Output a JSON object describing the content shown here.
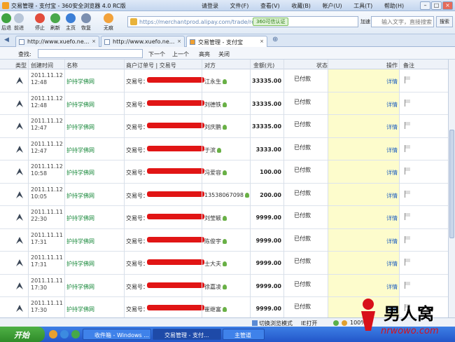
{
  "window": {
    "title": "交易管理 - 支付宝 - 360安全浏览器 4.0 RC版",
    "menus": [
      "请登录",
      "文件(F)",
      "查看(V)",
      "收藏(B)",
      "帐户(U)",
      "工具(T)",
      "帮助(H)"
    ]
  },
  "toolbar": {
    "buttons": [
      "后退",
      "前进",
      "停止",
      "刷新",
      "主页",
      "恢复",
      "无痕"
    ],
    "url": "https://merchantprod.alipay.com/trade/re",
    "cert": "360可信认证",
    "add": "加速",
    "search_placeholder": "输入文字，直接搜索",
    "search_btn": "搜索"
  },
  "tabs": [
    "http://www.xuefo.ne...",
    "http://www.xuefo.ne...",
    "交易管理 - 支付宝"
  ],
  "findbar": {
    "label": "查找:",
    "next": "下一个",
    "prev": "上一个",
    "highlight": "高亮",
    "close": "关闭"
  },
  "table": {
    "headers": [
      "类型",
      "创建时间",
      "名称",
      "商户订单号 | 交易号",
      "对方",
      "金额(元)",
      "状态",
      "操作",
      "备注"
    ],
    "rows": [
      {
        "date": "2011.11.12",
        "time": "12:48",
        "name": "护持学佛网",
        "order": "交易号：",
        "party": "江永生",
        "amount": "33335.00",
        "status": "已付款",
        "action": "详情"
      },
      {
        "date": "2011.11.12",
        "time": "12:48",
        "name": "护持学佛网",
        "order": "交易号：",
        "party": "刘德铁",
        "amount": "33335.00",
        "status": "已付款",
        "action": "详情"
      },
      {
        "date": "2011.11.12",
        "time": "12:47",
        "name": "护持学佛网",
        "order": "交易号：",
        "party": "刘庆鹏",
        "amount": "33335.00",
        "status": "已付款",
        "action": "详情"
      },
      {
        "date": "2011.11.12",
        "time": "12:47",
        "name": "护持学佛网",
        "order": "交易号：",
        "party": "于滨",
        "amount": "3333.00",
        "status": "已付款",
        "action": "详情"
      },
      {
        "date": "2011.11.12",
        "time": "10:58",
        "name": "护持学佛网",
        "order": "交易号：",
        "party": "冯爱容",
        "amount": "100.00",
        "status": "已付款",
        "action": "详情"
      },
      {
        "date": "2011.11.12",
        "time": "10:05",
        "name": "护持学佛网",
        "order": "交易号：",
        "party": "13538067098",
        "amount": "200.00",
        "status": "已付款",
        "action": "详情"
      },
      {
        "date": "2011.11.11",
        "time": "22:30",
        "name": "护持学佛网",
        "order": "交易号：",
        "party": "刘莹颖",
        "amount": "9999.00",
        "status": "已付款",
        "action": "详情"
      },
      {
        "date": "2011.11.11",
        "time": "17:31",
        "name": "护持学佛网",
        "order": "交易号：",
        "party": "陈俊宇",
        "amount": "9999.00",
        "status": "已付款",
        "action": "详情"
      },
      {
        "date": "2011.11.11",
        "time": "17:31",
        "name": "护持学佛网",
        "order": "交易号：",
        "party": "士大夫",
        "amount": "9999.00",
        "status": "已付款",
        "action": "详情"
      },
      {
        "date": "2011.11.11",
        "time": "17:30",
        "name": "护持学佛网",
        "order": "交易号：",
        "party": "徐嘉凌",
        "amount": "9999.00",
        "status": "已付款",
        "action": "详情"
      },
      {
        "date": "2011.11.11",
        "time": "17:30",
        "name": "护持学佛网",
        "order": "交易号：",
        "party": "崔继富",
        "amount": "9999.00",
        "status": "已付款",
        "action": "详情"
      }
    ]
  },
  "statusbar": {
    "mode": "切换浏览模式",
    "ie": "IE打开",
    "zoom": "100%"
  },
  "taskbar": {
    "start": "开始",
    "tasks": [
      "收件箱 - Windows ...",
      "交易管理 - 支付...",
      "主管道"
    ]
  },
  "watermark": {
    "brand": "男人窝",
    "url": "nrwowo.com"
  }
}
